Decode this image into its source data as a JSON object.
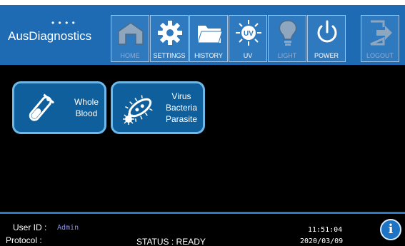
{
  "header": {
    "logo": {
      "text": "AusDiagnostics",
      "dots": "• • • •"
    },
    "nav": [
      {
        "id": "home",
        "label": "HOME",
        "enabled": false,
        "icon": "home-icon"
      },
      {
        "id": "settings",
        "label": "SETTINGS",
        "enabled": true,
        "icon": "gear-icon"
      },
      {
        "id": "history",
        "label": "HISTORY",
        "enabled": true,
        "icon": "folder-icon"
      },
      {
        "id": "uv",
        "label": "UV",
        "enabled": true,
        "icon": "uv-icon"
      },
      {
        "id": "light",
        "label": "LIGHT",
        "enabled": false,
        "icon": "lightbulb-icon"
      },
      {
        "id": "power",
        "label": "POWER",
        "enabled": true,
        "icon": "power-icon"
      },
      {
        "id": "logout",
        "label": "LOGOUT",
        "enabled": false,
        "icon": "logout-icon"
      }
    ]
  },
  "main": {
    "tiles": [
      {
        "id": "whole-blood",
        "lines": [
          "Whole",
          "Blood"
        ],
        "icon": "test-tube-icon"
      },
      {
        "id": "virus-bacteria-parasite",
        "lines": [
          "Virus",
          "Bacteria",
          "Parasite"
        ],
        "icon": "microbe-icon"
      }
    ]
  },
  "footer": {
    "user_label": "User ID :",
    "user_value": "Admin",
    "protocol_label": "Protocol :",
    "status_label": "STATUS : READY",
    "time": "11:51:04",
    "date": "2020/03/09"
  },
  "colors": {
    "header_bg": "#1f6bb3",
    "tile_bg": "#0f5f9c",
    "tile_border": "#6db8e6",
    "accent": "#1d74c4"
  }
}
